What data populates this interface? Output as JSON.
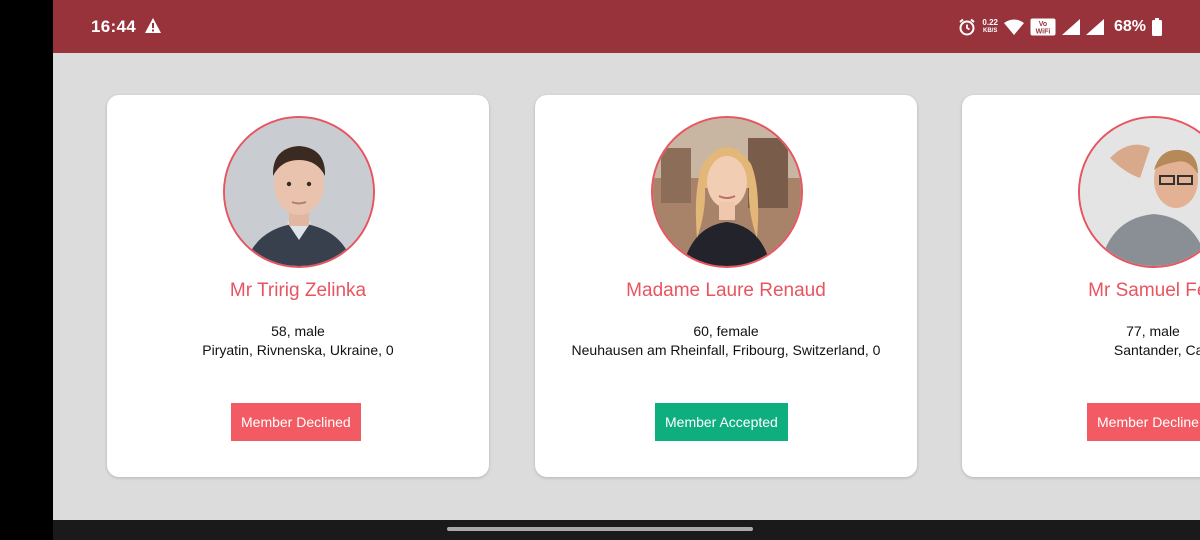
{
  "status_bar": {
    "time": "16:44",
    "net_speed_value": "0.22",
    "net_speed_unit": "KB/S",
    "volte_label": "Vo WiFi",
    "battery": "68%"
  },
  "colors": {
    "status_bar": "#98333b",
    "accent": "#e8545f",
    "declined": "#f25b63",
    "accepted": "#0fae7e",
    "background": "#dcdcdc"
  },
  "members": [
    {
      "name": "Mr Tririg Zelinka",
      "age_gender": "58, male",
      "location": "Piryatin, Rivnenska, Ukraine, 0",
      "status": "Member Declined"
    },
    {
      "name": "Madame Laure Renaud",
      "age_gender": "60, female",
      "location": "Neuhausen am Rheinfall, Fribourg, Switzerland, 0",
      "status": "Member Accepted"
    },
    {
      "name": "Mr Samuel Fer",
      "age_gender": "77, male",
      "location": "Santander, Cantabria,",
      "status": "Member Decline"
    }
  ]
}
